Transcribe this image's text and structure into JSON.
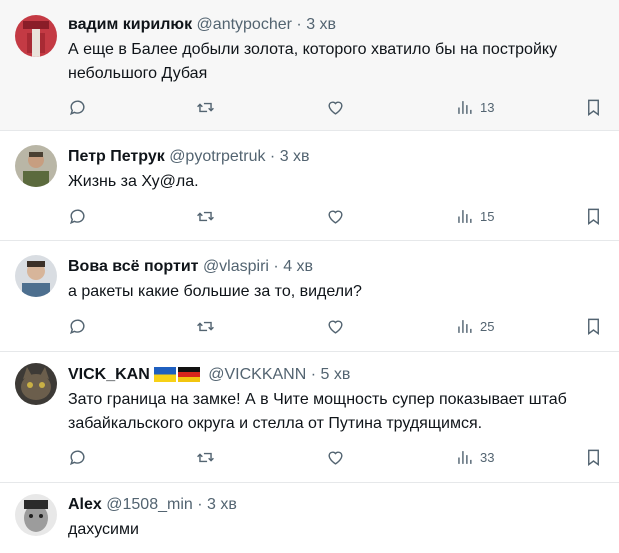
{
  "tweets": [
    {
      "name": "вадим кирилюк",
      "handle": "@antypocher",
      "sep": "·",
      "time": "3 хв",
      "text": "А еще в Балее добыли золота, которого хватило бы на постройку небольшого Дубая",
      "views": "13"
    },
    {
      "name": "Петр Петрук",
      "handle": "@pyotrpetruk",
      "sep": "·",
      "time": "3 хв",
      "text": "Жизнь за Ху@ла.",
      "views": "15"
    },
    {
      "name": "Вова всё портит",
      "handle": "@vlaspiri",
      "sep": "·",
      "time": "4 хв",
      "text": "а ракеты какие большие за то, видели?",
      "views": "25"
    },
    {
      "name": "VICK_KAN",
      "handle": "@VICKKANN",
      "sep": "·",
      "time": "5 хв",
      "text": "Зато граница на замке! А в Чите мощность супер показывает  штаб забайкальского округа и стелла от Путина трудящимся.",
      "views": "33"
    },
    {
      "name": "Alex",
      "handle": "@1508_min",
      "sep": "·",
      "time": "3 хв",
      "text": "дахусими"
    }
  ],
  "icons": {
    "reply": "reply-icon",
    "retweet": "retweet-icon",
    "like": "heart-icon",
    "views": "views-icon",
    "bookmark": "bookmark-icon"
  },
  "colors": {
    "text": "#0f1419",
    "muted": "#536471",
    "divider": "#e6e8ea",
    "hover_bg": "#f7f7f7"
  }
}
